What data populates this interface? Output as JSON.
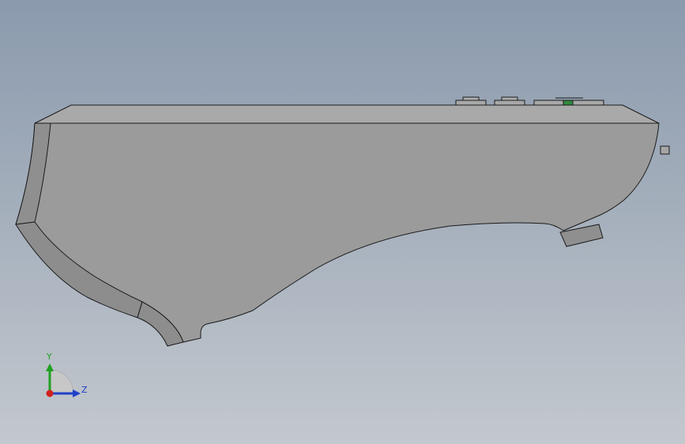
{
  "viewport": {
    "background_top": "#8b9aae",
    "background_bottom": "#c3c8ce"
  },
  "model": {
    "face_color": "#9b9b9b",
    "top_face_color": "#a7a7a7",
    "bevel_color": "#8e8e8e",
    "edge_color": "#1a1a1a",
    "indicator_color": "#2f8a3a"
  },
  "triad": {
    "y_label": "Y",
    "z_label": "Z",
    "y_color": "#20a020",
    "z_color": "#2040c8",
    "x_color": "#d02020",
    "icon": "view-orientation-triad-icon"
  }
}
